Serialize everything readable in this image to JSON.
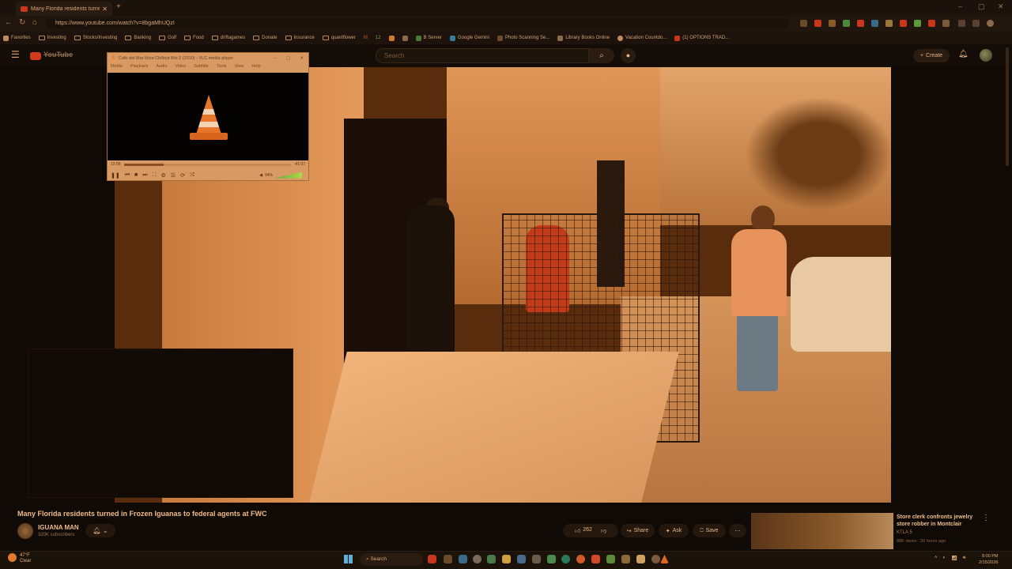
{
  "browser": {
    "tab_title": "Many Florida residents turned in F",
    "url": "https://www.youtube.com/watch?v=8bgaMhUQzI",
    "bookmarks": [
      "Favorites",
      "Investing",
      "Stocks/Investing",
      "Banking",
      "Golf",
      "Food",
      "driftagames",
      "Donate",
      "Insurance",
      "quantflower",
      "M",
      "12",
      "B Server",
      "Google Gemini",
      "Photo Scanning Se...",
      "Library Books Online",
      "Vacation Countdo...",
      "(1) OPTIONS TRAD..."
    ]
  },
  "youtube": {
    "search_placeholder": "Search",
    "create_label": "Create",
    "video_title": "Many Florida residents turned in Frozen Iguanas to federal agents at FWC",
    "channel_name": "IGUANA MAN",
    "subscribers": "320K subscribers",
    "likes": "262",
    "share_label": "Share",
    "ask_label": "Ask",
    "save_label": "Save",
    "suggestion": {
      "title": "Store clerk confronts jewelry store robber in Montclair",
      "channel": "KTLA 5",
      "meta": "88K views · 20 hours ago"
    }
  },
  "vlc": {
    "title": "Cafe del Mar Ibiza Chillout Mix 2 (2010) - VLC media player",
    "menu": [
      "Media",
      "Playback",
      "Audio",
      "Video",
      "Subtitle",
      "Tools",
      "View",
      "Help"
    ],
    "elapsed": "12:56",
    "remaining": "-41:57",
    "progress": 0.24,
    "volume": "94%"
  },
  "taskbar": {
    "temp": "47°F",
    "condition": "Clear",
    "search_label": "Search",
    "time": "8:00 PM",
    "date": "2/15/2026"
  },
  "colors": {
    "accent": "#e08a4a",
    "youtube_red": "#d03a1d",
    "vlc_orange": "#e0661e"
  }
}
